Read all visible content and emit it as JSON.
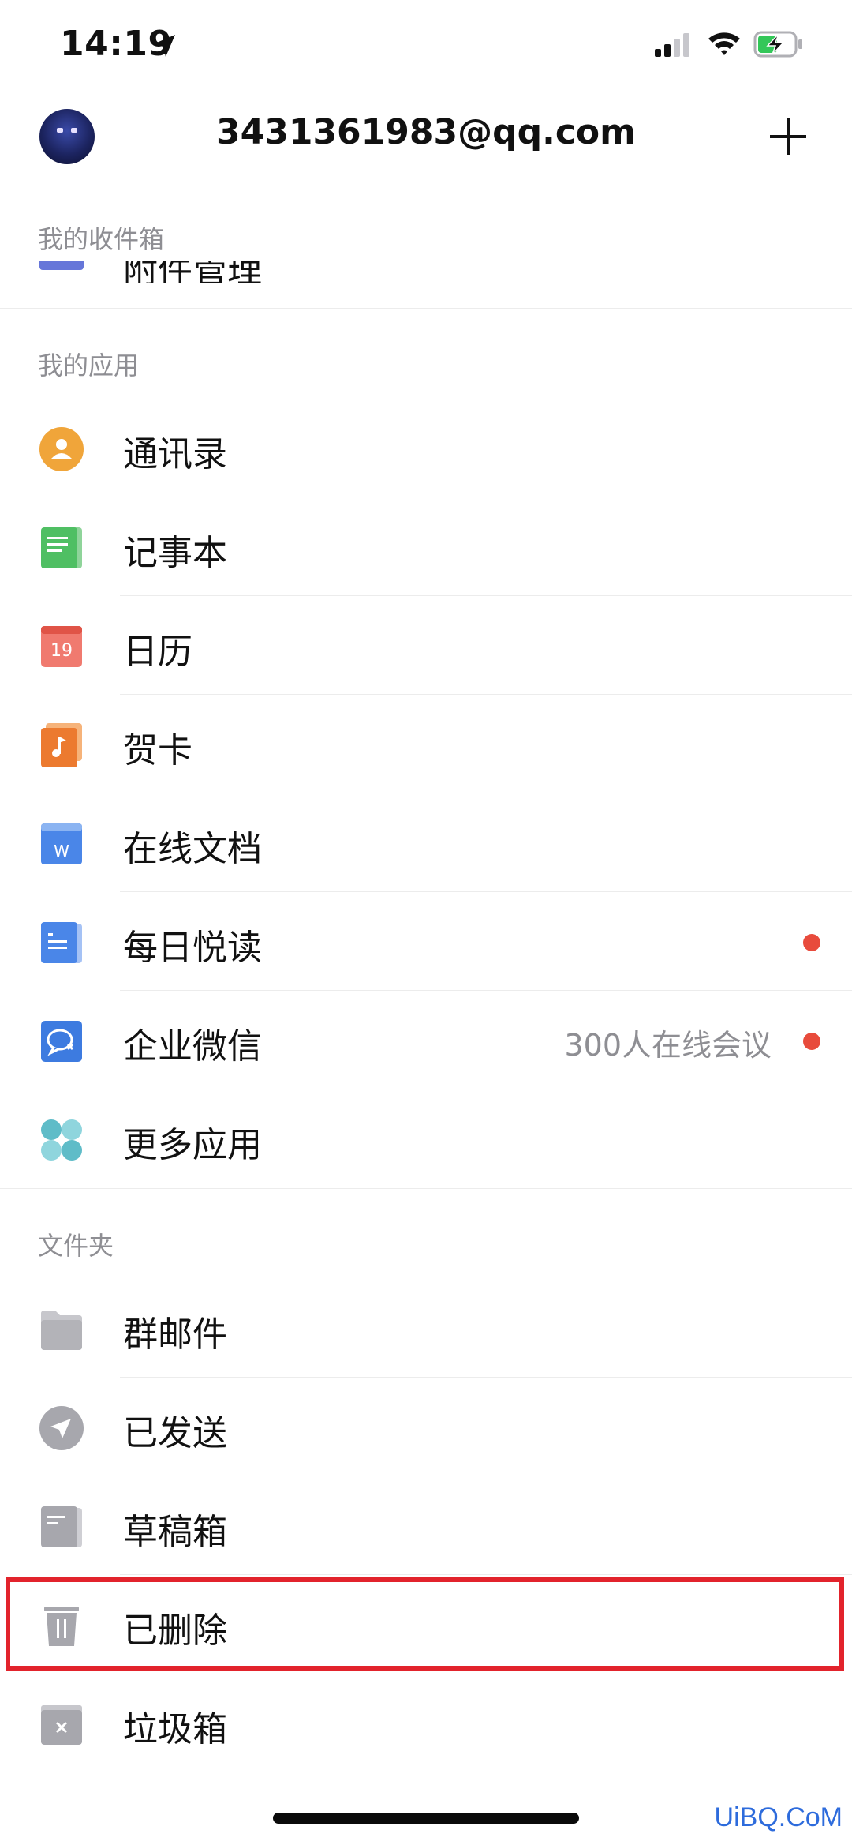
{
  "status_bar": {
    "time": "14:19"
  },
  "header": {
    "email": "3431361983@qq.com"
  },
  "inbox_section": {
    "title": "我的收件箱",
    "partial_item": "附件管理"
  },
  "apps_section": {
    "title": "我的应用",
    "items": [
      {
        "label": "通讯录",
        "icon": "contacts-icon"
      },
      {
        "label": "记事本",
        "icon": "notepad-icon"
      },
      {
        "label": "日历",
        "icon": "calendar-icon",
        "icon_text": "19"
      },
      {
        "label": "贺卡",
        "icon": "greeting-card-icon"
      },
      {
        "label": "在线文档",
        "icon": "online-doc-icon",
        "icon_text": "W"
      },
      {
        "label": "每日悦读",
        "icon": "daily-reading-icon"
      },
      {
        "label": "企业微信",
        "icon": "wecom-icon",
        "extra": "300人在线会议"
      },
      {
        "label": "更多应用",
        "icon": "more-apps-icon"
      }
    ]
  },
  "folders_section": {
    "title": "文件夹",
    "items": [
      {
        "label": "群邮件",
        "icon": "folder-icon"
      },
      {
        "label": "已发送",
        "icon": "sent-icon"
      },
      {
        "label": "草稿箱",
        "icon": "drafts-icon"
      },
      {
        "label": "已删除",
        "icon": "trash-icon"
      },
      {
        "label": "垃圾箱",
        "icon": "spam-icon"
      }
    ]
  },
  "watermark": "UiBQ.CoM",
  "colors": {
    "highlight": "#e2232c",
    "badge": "#e84b3c",
    "secondary_text": "#8e8e93"
  }
}
